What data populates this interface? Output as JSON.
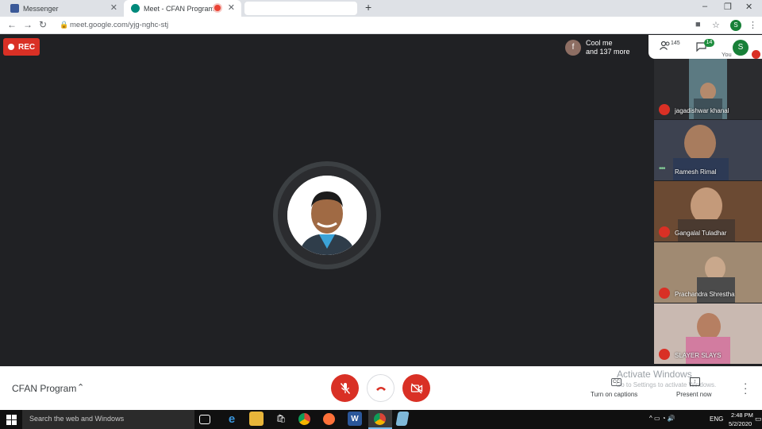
{
  "browser": {
    "tabs": [
      {
        "title": "Messenger",
        "icon": "messenger-icon",
        "active": false
      },
      {
        "title": "Meet - CFAN Program",
        "icon": "meet-icon",
        "active": true,
        "recording": true
      }
    ],
    "url": "meet.google.com/yjg-nghc-stj",
    "profile_initial": "S"
  },
  "meet": {
    "recording_label": "REC",
    "join_toast": {
      "avatar_initial": "f",
      "line1": "Cool me",
      "line2": "and 137 more"
    },
    "people_count": "145",
    "chat_count": "14",
    "self": {
      "initial": "S",
      "label": "You",
      "muted": true
    },
    "participants": [
      {
        "name": "jagadishwar khanal",
        "status": "muted",
        "bg": "#5c7a82"
      },
      {
        "name": "Ramesh Rimal",
        "status": "speaking",
        "bg": "#3d4250"
      },
      {
        "name": "Gangalal Tuladhar",
        "status": "muted",
        "bg": "#6b4a33"
      },
      {
        "name": "Prachandra Shrestha",
        "status": "muted",
        "bg": "#a08a72"
      },
      {
        "name": "SLAYER SLAYS",
        "status": "muted",
        "bg": "#c9b9b1"
      }
    ],
    "meeting_name": "CFAN Program",
    "captions_label": "Turn on captions",
    "present_label": "Present now",
    "activate_title": "Activate Windows",
    "activate_sub": "Go to Settings to activate Windows.",
    "colors": {
      "danger": "#d93025",
      "accent": "#188038",
      "stage": "#202124"
    }
  },
  "taskbar": {
    "search_placeholder": "Search the web and Windows",
    "lang": "ENG",
    "time": "2:48 PM",
    "date": "5/2/2020"
  }
}
